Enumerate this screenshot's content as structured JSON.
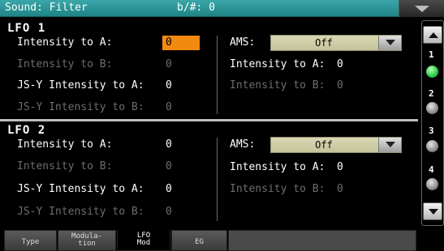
{
  "header": {
    "title": "Sound: Filter",
    "transpose": "b/#: 0"
  },
  "lfo1": {
    "title": "LFO 1",
    "rows": [
      {
        "label": "Intensity to A:",
        "value": "0"
      },
      {
        "label": "Intensity to B:",
        "value": "0"
      },
      {
        "label": "JS-Y Intensity to A:",
        "value": "0"
      },
      {
        "label": "JS-Y Intensity to B:",
        "value": "0"
      }
    ],
    "ams_label": "AMS:",
    "ams_value": "Off",
    "ams_rows": [
      {
        "label": "Intensity to A:",
        "value": "0"
      },
      {
        "label": "Intensity to B:",
        "value": "0"
      }
    ]
  },
  "lfo2": {
    "title": "LFO 2",
    "rows": [
      {
        "label": "Intensity to A:",
        "value": "0"
      },
      {
        "label": "Intensity to B:",
        "value": "0"
      },
      {
        "label": "JS-Y Intensity to A:",
        "value": "0"
      },
      {
        "label": "JS-Y Intensity to B:",
        "value": "0"
      }
    ],
    "ams_label": "AMS:",
    "ams_value": "Off",
    "ams_rows": [
      {
        "label": "Intensity to A:",
        "value": "0"
      },
      {
        "label": "Intensity to B:",
        "value": "0"
      }
    ]
  },
  "sidebar": {
    "items": [
      "1",
      "2",
      "3",
      "4"
    ],
    "active_index": 0
  },
  "tabs": [
    {
      "line1": "Type",
      "line2": ""
    },
    {
      "line1": "Modula-",
      "line2": "tion"
    },
    {
      "line1": "LFO",
      "line2": "Mod"
    },
    {
      "line1": "EG",
      "line2": ""
    }
  ],
  "colors": {
    "title_bar": "#2a9597",
    "selected": "#f38a10",
    "led_active": "#2ed14c",
    "combo": "#d2d1ab"
  }
}
